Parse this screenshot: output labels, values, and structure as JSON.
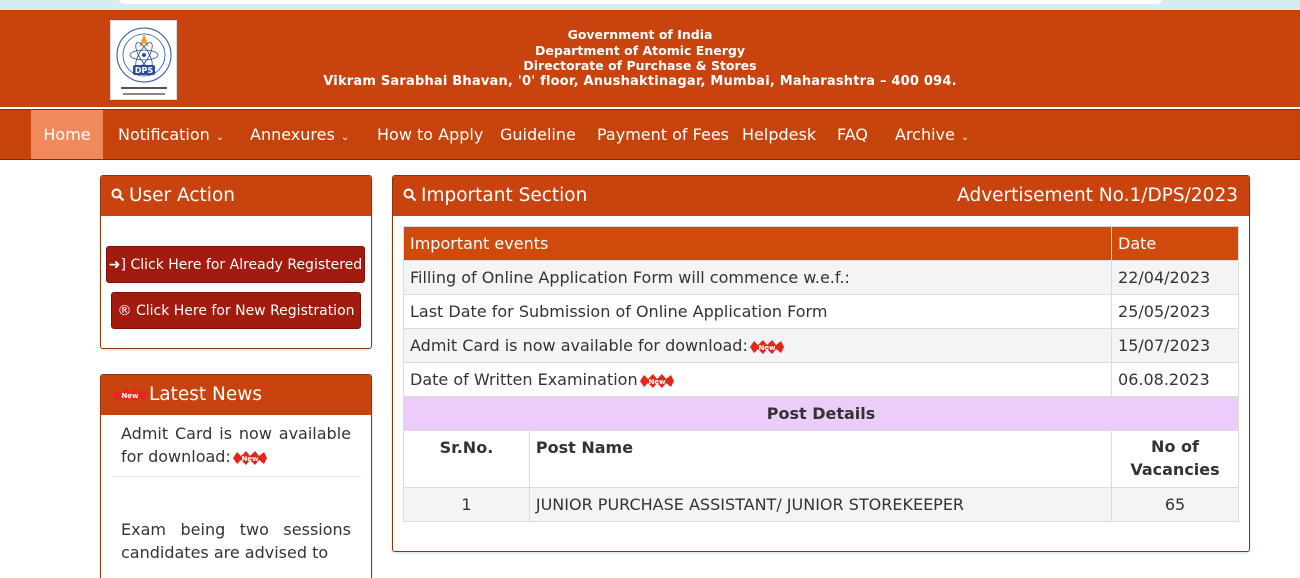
{
  "header": {
    "line1": "Government of India",
    "line2": "Department of Atomic Energy",
    "line3": "Directorate of Purchase & Stores",
    "line4": "Vikram Sarabhai Bhavan, '0' floor, Anushaktinagar, Mumbai, Maharashtra – 400 094.",
    "logo_text": "DPS"
  },
  "nav": {
    "home": "Home",
    "notification": "Notification",
    "annexures": "Annexures",
    "how_to_apply": "How to Apply",
    "guideline": "Guideline",
    "payment": "Payment of Fees",
    "helpdesk": "Helpdesk",
    "faq": "FAQ",
    "archive": "Archive"
  },
  "user_action": {
    "title": "User Action",
    "registered_button": "Click Here for Already Registered",
    "new_registration_button": "Click Here for New Registration"
  },
  "latest_news": {
    "title": "Latest News",
    "item1": "Admit Card is now available for download:",
    "item2": "Exam being two sessions candidates are advised to"
  },
  "important": {
    "title": "Important Section",
    "advertisement": "Advertisement No.1/DPS/2023",
    "col_event": "Important events",
    "col_date": "Date",
    "events": [
      {
        "event": "Filling of Online Application Form will commence w.e.f.:",
        "date": "22/04/2023",
        "new": false
      },
      {
        "event": "Last Date for Submission of Online Application Form",
        "date": "25/05/2023",
        "new": false
      },
      {
        "event": "Admit Card is now available for download:",
        "date": "15/07/2023",
        "new": true
      },
      {
        "event": "Date of Written Examination",
        "date": "06.08.2023",
        "new": true
      }
    ],
    "post_details_title": "Post Details",
    "post_cols": {
      "sr": "Sr.No.",
      "name": "Post Name",
      "vacancies": "No of Vacancies"
    },
    "posts": [
      {
        "sr": "1",
        "name": "JUNIOR PURCHASE ASSISTANT/ JUNIOR STOREKEEPER",
        "vacancies": "65"
      }
    ]
  },
  "badge_text": "New",
  "colors": {
    "header_bg": "#c9430e",
    "button_bg": "#a11b0e",
    "active_nav": "#f08a5d",
    "post_details_bg": "#ecccf8"
  }
}
